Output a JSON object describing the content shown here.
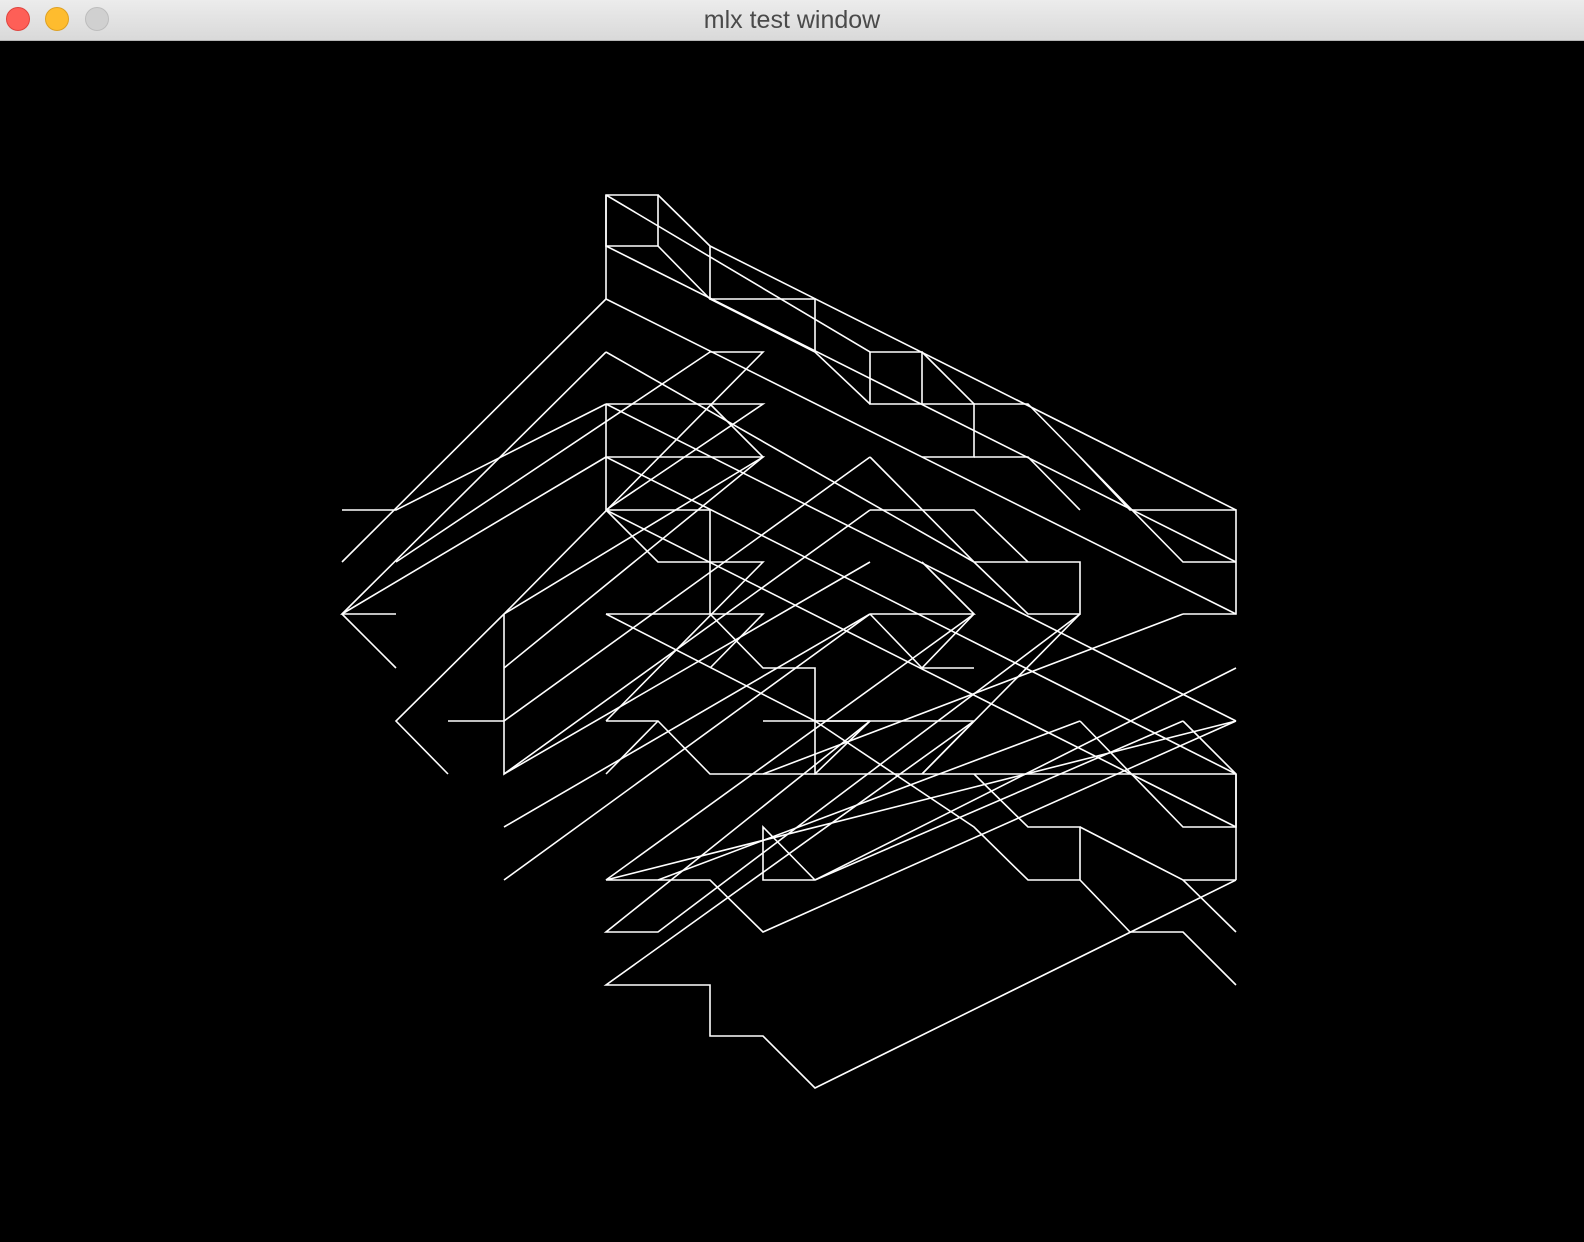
{
  "window": {
    "title": "mlx test window",
    "controls": {
      "close_color": "#fe5f57",
      "minimize_color": "#febc2e",
      "zoom_color": "#d0d0d0"
    }
  },
  "canvas": {
    "background": "#000000",
    "wire_color": "#ffffff"
  }
}
